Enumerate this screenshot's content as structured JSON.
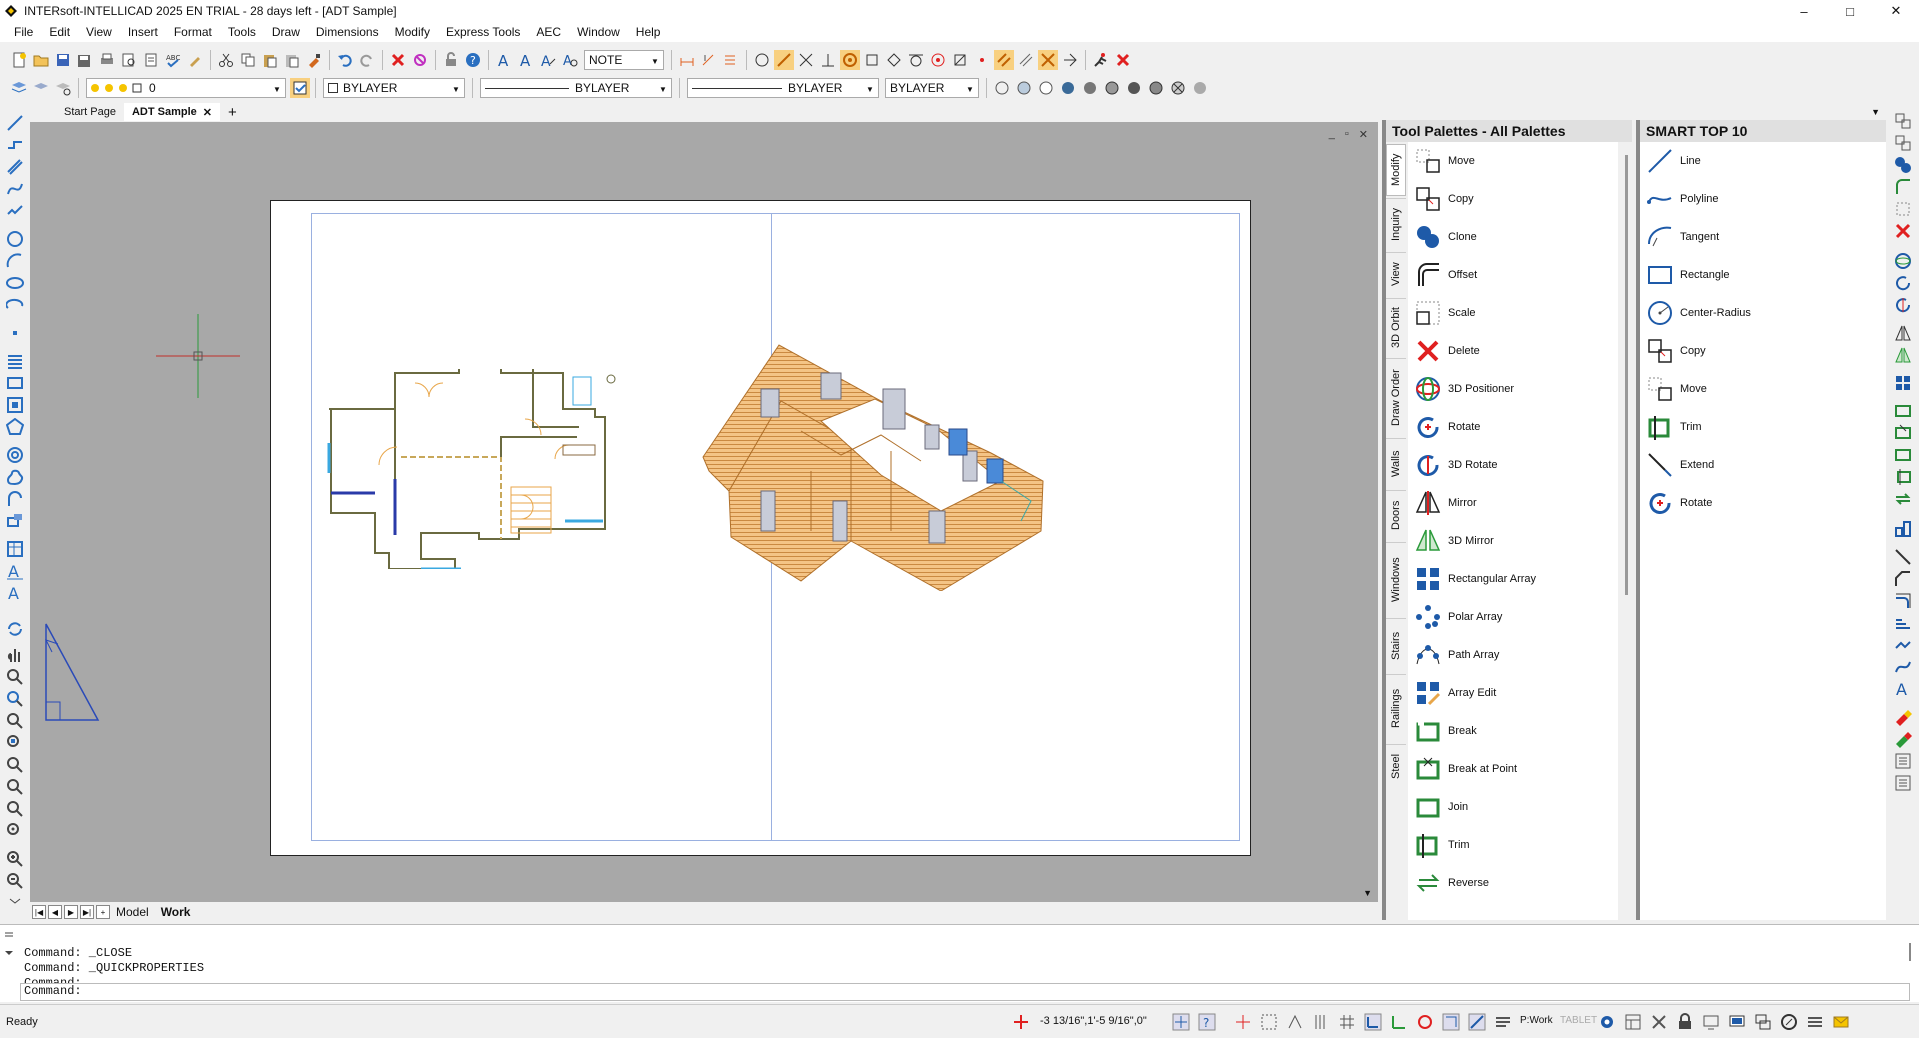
{
  "window": {
    "title": "INTERsoft-INTELLICAD 2025 EN TRIAL - 28 days left - [ADT Sample]",
    "minimize": "–",
    "maximize": "□",
    "close": "✕"
  },
  "menu": [
    "File",
    "Edit",
    "View",
    "Insert",
    "Format",
    "Tools",
    "Draw",
    "Dimensions",
    "Modify",
    "Express Tools",
    "AEC",
    "Window",
    "Help"
  ],
  "toolbar": {
    "text_style": "NOTE",
    "layer": "0",
    "color": "BYLAYER",
    "linetype": "BYLAYER",
    "lineweight": "BYLAYER",
    "plotstyle": "BYLAYER"
  },
  "doc_tabs": {
    "start": "Start Page",
    "active": "ADT Sample",
    "close": "✕",
    "add": "+"
  },
  "layout_tabs": {
    "model": "Model",
    "work": "Work",
    "add": "+"
  },
  "palette": {
    "title": "Tool Palettes - All Palettes",
    "vtabs": [
      "Modify",
      "Inquiry",
      "View",
      "3D Orbit",
      "Draw Order",
      "Walls",
      "Doors",
      "Windows",
      "Stairs",
      "Railings",
      "Steel"
    ],
    "items": [
      "Move",
      "Copy",
      "Clone",
      "Offset",
      "Scale",
      "Delete",
      "3D Positioner",
      "Rotate",
      "3D Rotate",
      "Mirror",
      "3D Mirror",
      "Rectangular Array",
      "Polar Array",
      "Path Array",
      "Array Edit",
      "Break",
      "Break at Point",
      "Join",
      "Trim",
      "Reverse"
    ]
  },
  "smart": {
    "title": "SMART TOP 10",
    "items": [
      "Line",
      "Polyline",
      "Tangent",
      "Rectangle",
      "Center-Radius",
      "Copy",
      "Move",
      "Trim",
      "Extend",
      "Rotate"
    ]
  },
  "command": {
    "lines": [
      "Command:  _CLOSE",
      "Command:  _QUICKPROPERTIES",
      "Command:"
    ],
    "prompt": "Command:"
  },
  "status": {
    "ready": "Ready",
    "coords": "-3 13/16\",1'-5 9/16\",0\"",
    "workspace": "P:Work",
    "tablet": "TABLET"
  },
  "colors": {
    "accent": "#1e5aa8",
    "drawing_bg": "#a8a8a8",
    "house_outline": "#e8a64a"
  }
}
